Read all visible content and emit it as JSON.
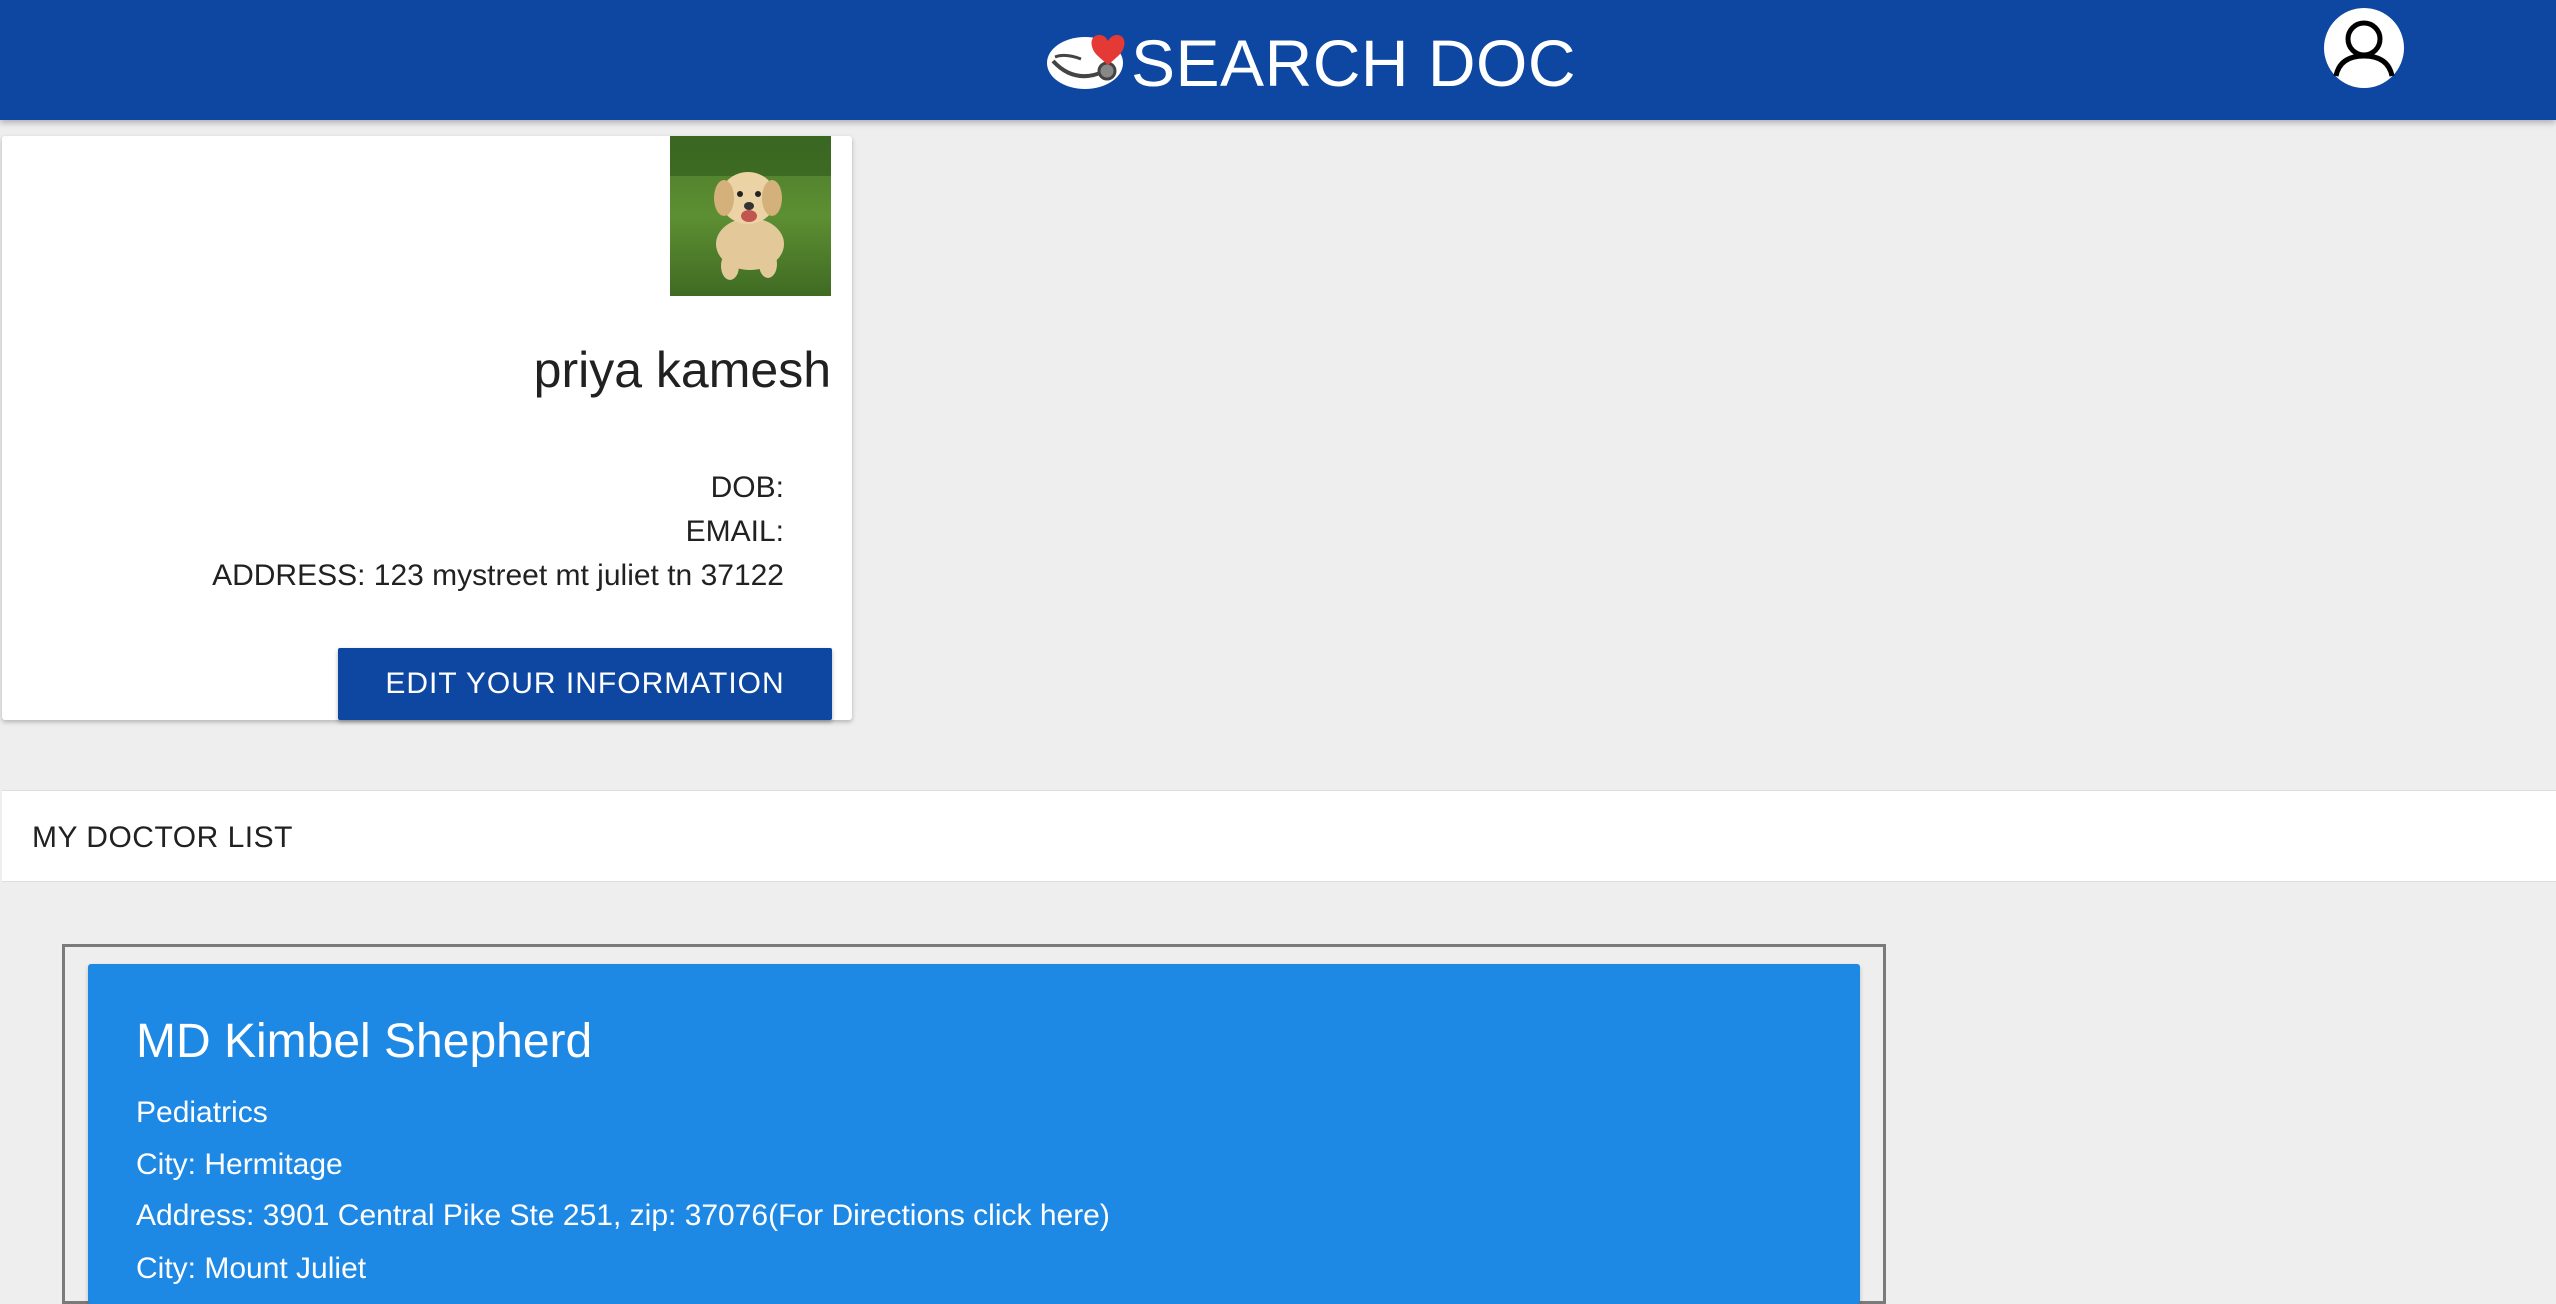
{
  "header": {
    "title": "SEARCH DOC",
    "logo_icon": "heart-stethoscope-logo",
    "account_icon": "user-account-icon"
  },
  "profile": {
    "name": "priya kamesh",
    "dob_label": "DOB:",
    "dob_value": "",
    "email_label": "EMAIL:",
    "email_value": "",
    "address_label": "ADDRESS:",
    "address_value": "123 mystreet mt juliet tn 37122",
    "edit_button": "EDIT YOUR INFORMATION"
  },
  "doctor_list": {
    "title": "MY DOCTOR LIST",
    "doctors": [
      {
        "name": "MD Kimbel Shepherd",
        "specialty": "Pediatrics",
        "city_label": "City:",
        "city": "Hermitage",
        "address_label": "Address:",
        "address": "3901 Central Pike Ste 251",
        "zip_label": "zip:",
        "zip": "37076",
        "directions_link": "(For Directions click here)",
        "city2_label": "City:",
        "city2": "Mount Juliet"
      }
    ]
  },
  "colors": {
    "header_bg": "#0d47a1",
    "doctor_card_bg": "#1e88e5",
    "page_bg": "#eeeeee"
  }
}
